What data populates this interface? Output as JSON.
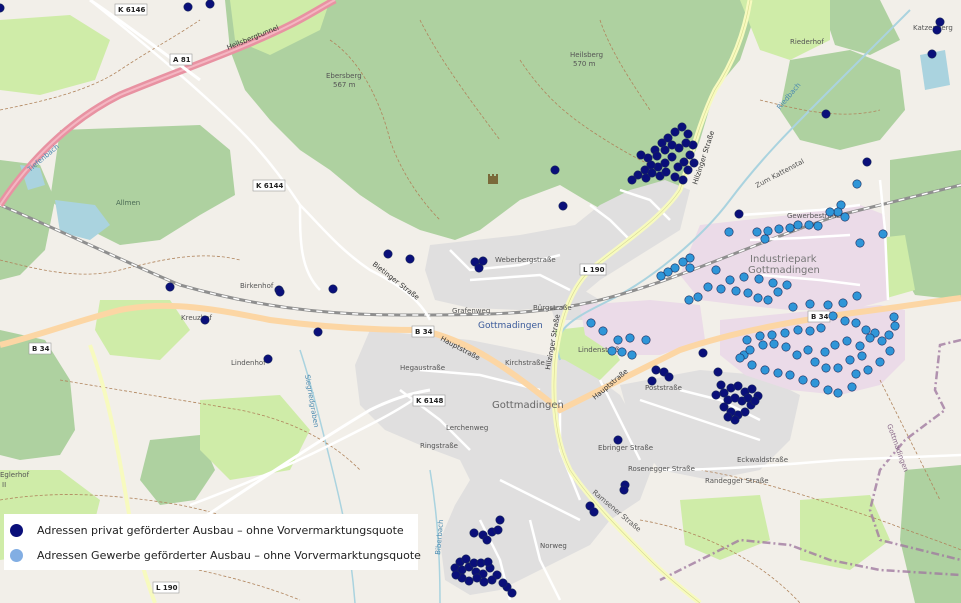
{
  "map": {
    "colors": {
      "land": "#f2efe9",
      "forest": "#aed1a0",
      "forest_dark": "#9cc38c",
      "meadow": "#cfeca8",
      "residential": "#e0dfdf",
      "industrial": "#ebdbe8",
      "motorway": "#e892a2",
      "primary": "#fcd6a4",
      "secondary": "#f7fabf",
      "road": "#ffffff",
      "rail": "#8f8f8f",
      "water": "#aad3df",
      "boundary": "#a07aa0",
      "private_dot": "#0a0f7a",
      "commercial_dot": "#2f96d8"
    },
    "labels": {
      "k6146": "K 6146",
      "heilsbergtunnel": "Heilsbergtunnel",
      "a81": "A 81",
      "ebersberg": "Ebersberg",
      "ebersberg_ele": "567 m",
      "heilsberg": "Heilsberg",
      "heilsberg_ele": "570 m",
      "riederhof": "Riederhof",
      "katzenberg": "Katzenberg",
      "k6144": "K 6144",
      "allmen": "Allmen",
      "birkenhof": "Birkenhof",
      "kreuzhof": "Kreuzhof",
      "lindenhof": "Lindenhof",
      "b34_w": "B 34",
      "b34_c": "B 34",
      "b34_e": "B 34",
      "l190_n": "L 190",
      "l190_s": "L 190",
      "k6148": "K 6148",
      "gottmadingen_station": "Gottmadingen",
      "gottmadingen_town": "Gottmadingen",
      "industriepark": "Industriepark",
      "industriepark2": "Gottmadingen",
      "hauptstrasse": "Hauptstraße",
      "hauptstrasse2": "Hauptstraße",
      "hilzinger": "Hilzinger Straße",
      "hilzinger2": "Hilzinger Straße",
      "bietinger": "Bietinger Straße",
      "gewerbestrasse": "Gewerbestraße",
      "zum_kattenstal": "Zum Kattenstal",
      "grafenweg": "Grafenweg",
      "buergstrasse": "Bürgstraße",
      "rosenegger": "Rosenegger Straße",
      "randegger": "Randegger Straße",
      "eckwaldstrasse": "Eckwaldstraße",
      "lindenstrasse": "Lindenstraße",
      "poststrasse": "Poststraße",
      "norweg": "Norweg",
      "ramsener": "Ramsener Straße",
      "ebringer": "Ebringer Straße",
      "hegau": "Hegaustraße",
      "lerchen": "Lerchenweg",
      "weberbergstrasse": "Weberbergstraße",
      "kirchstrasse": "Kirchstraße",
      "ringstrasse": "Ringstraße",
      "riedbach": "Riedbach",
      "biberbach": "Biberbach",
      "siegriedgraben": "Siegriedgraben",
      "tiefenbach": "Tiefenbach",
      "gottmadingen_line": "Gottmadingen",
      "eglerhof": "Eglerhof",
      "eglerhof2": "II"
    },
    "points_private": [
      [
        0,
        8
      ],
      [
        188,
        7
      ],
      [
        210,
        4
      ],
      [
        940,
        22
      ],
      [
        937,
        30
      ],
      [
        932,
        54
      ],
      [
        826,
        114
      ],
      [
        867,
        162
      ],
      [
        555,
        170
      ],
      [
        563,
        206
      ],
      [
        483,
        261
      ],
      [
        475,
        262
      ],
      [
        479,
        268
      ],
      [
        388,
        254
      ],
      [
        410,
        259
      ],
      [
        333,
        289
      ],
      [
        279,
        290
      ],
      [
        280,
        292
      ],
      [
        170,
        287
      ],
      [
        205,
        320
      ],
      [
        318,
        332
      ],
      [
        268,
        359
      ],
      [
        739,
        214
      ],
      [
        703,
        353
      ],
      [
        656,
        370
      ],
      [
        664,
        372
      ],
      [
        669,
        377
      ],
      [
        652,
        381
      ],
      [
        618,
        440
      ],
      [
        625,
        485
      ],
      [
        624,
        490
      ],
      [
        590,
        506
      ],
      [
        594,
        512
      ],
      [
        641,
        155
      ],
      [
        648,
        158
      ],
      [
        655,
        150
      ],
      [
        662,
        143
      ],
      [
        668,
        138
      ],
      [
        675,
        132
      ],
      [
        682,
        127
      ],
      [
        688,
        134
      ],
      [
        693,
        145
      ],
      [
        690,
        155
      ],
      [
        684,
        162
      ],
      [
        678,
        167
      ],
      [
        672,
        157
      ],
      [
        665,
        163
      ],
      [
        658,
        167
      ],
      [
        651,
        165
      ],
      [
        645,
        170
      ],
      [
        638,
        175
      ],
      [
        632,
        180
      ],
      [
        646,
        178
      ],
      [
        652,
        173
      ],
      [
        660,
        176
      ],
      [
        666,
        172
      ],
      [
        675,
        177
      ],
      [
        683,
        180
      ],
      [
        688,
        170
      ],
      [
        694,
        163
      ],
      [
        686,
        143
      ],
      [
        679,
        148
      ],
      [
        672,
        145
      ],
      [
        665,
        150
      ],
      [
        657,
        156
      ],
      [
        718,
        372
      ],
      [
        721,
        385
      ],
      [
        716,
        395
      ],
      [
        724,
        393
      ],
      [
        731,
        388
      ],
      [
        738,
        386
      ],
      [
        745,
        392
      ],
      [
        752,
        389
      ],
      [
        758,
        396
      ],
      [
        751,
        405
      ],
      [
        745,
        412
      ],
      [
        738,
        415
      ],
      [
        731,
        412
      ],
      [
        724,
        407
      ],
      [
        728,
        400
      ],
      [
        735,
        398
      ],
      [
        742,
        401
      ],
      [
        748,
        398
      ],
      [
        735,
        420
      ],
      [
        728,
        417
      ],
      [
        755,
        401
      ],
      [
        474,
        533
      ],
      [
        483,
        535
      ],
      [
        492,
        532
      ],
      [
        500,
        520
      ],
      [
        498,
        530
      ],
      [
        487,
        540
      ],
      [
        455,
        568
      ],
      [
        462,
        570
      ],
      [
        469,
        567
      ],
      [
        476,
        572
      ],
      [
        483,
        574
      ],
      [
        490,
        568
      ],
      [
        497,
        575
      ],
      [
        492,
        580
      ],
      [
        484,
        582
      ],
      [
        477,
        578
      ],
      [
        469,
        581
      ],
      [
        462,
        578
      ],
      [
        456,
        575
      ],
      [
        460,
        562
      ],
      [
        466,
        559
      ],
      [
        474,
        563
      ],
      [
        481,
        563
      ],
      [
        488,
        562
      ],
      [
        507,
        587
      ],
      [
        512,
        593
      ],
      [
        503,
        583
      ]
    ],
    "points_commercial": [
      [
        857,
        184
      ],
      [
        841,
        205
      ],
      [
        838,
        212
      ],
      [
        845,
        217
      ],
      [
        830,
        212
      ],
      [
        818,
        226
      ],
      [
        809,
        225
      ],
      [
        798,
        225
      ],
      [
        790,
        228
      ],
      [
        779,
        229
      ],
      [
        768,
        231
      ],
      [
        757,
        232
      ],
      [
        765,
        239
      ],
      [
        729,
        232
      ],
      [
        860,
        243
      ],
      [
        883,
        234
      ],
      [
        690,
        258
      ],
      [
        683,
        262
      ],
      [
        675,
        268
      ],
      [
        668,
        272
      ],
      [
        661,
        276
      ],
      [
        690,
        268
      ],
      [
        716,
        270
      ],
      [
        730,
        280
      ],
      [
        744,
        277
      ],
      [
        759,
        279
      ],
      [
        773,
        283
      ],
      [
        787,
        285
      ],
      [
        689,
        300
      ],
      [
        698,
        297
      ],
      [
        708,
        287
      ],
      [
        721,
        289
      ],
      [
        736,
        291
      ],
      [
        748,
        293
      ],
      [
        758,
        298
      ],
      [
        768,
        300
      ],
      [
        778,
        292
      ],
      [
        793,
        307
      ],
      [
        810,
        304
      ],
      [
        828,
        305
      ],
      [
        843,
        303
      ],
      [
        857,
        296
      ],
      [
        591,
        323
      ],
      [
        603,
        331
      ],
      [
        618,
        340
      ],
      [
        630,
        338
      ],
      [
        612,
        351
      ],
      [
        622,
        352
      ],
      [
        632,
        355
      ],
      [
        646,
        340
      ],
      [
        894,
        317
      ],
      [
        895,
        326
      ],
      [
        889,
        335
      ],
      [
        882,
        341
      ],
      [
        875,
        333
      ],
      [
        866,
        330
      ],
      [
        856,
        323
      ],
      [
        845,
        321
      ],
      [
        833,
        316
      ],
      [
        821,
        328
      ],
      [
        810,
        331
      ],
      [
        798,
        330
      ],
      [
        785,
        333
      ],
      [
        772,
        335
      ],
      [
        760,
        336
      ],
      [
        747,
        340
      ],
      [
        744,
        355
      ],
      [
        752,
        365
      ],
      [
        765,
        370
      ],
      [
        778,
        373
      ],
      [
        790,
        375
      ],
      [
        803,
        380
      ],
      [
        815,
        383
      ],
      [
        828,
        390
      ],
      [
        838,
        393
      ],
      [
        852,
        387
      ],
      [
        856,
        374
      ],
      [
        868,
        370
      ],
      [
        880,
        362
      ],
      [
        890,
        351
      ],
      [
        825,
        352
      ],
      [
        835,
        345
      ],
      [
        847,
        341
      ],
      [
        860,
        346
      ],
      [
        870,
        338
      ],
      [
        815,
        362
      ],
      [
        826,
        368
      ],
      [
        838,
        368
      ],
      [
        850,
        360
      ],
      [
        862,
        356
      ],
      [
        808,
        350
      ],
      [
        797,
        355
      ],
      [
        786,
        347
      ],
      [
        774,
        344
      ],
      [
        763,
        345
      ],
      [
        750,
        350
      ],
      [
        740,
        358
      ]
    ]
  },
  "legend": {
    "private_label": "Adressen privat geförderter Ausbau – ohne Vorvermarktungsquote",
    "commercial_label": "Adressen Gewerbe geförderter Ausbau – ohne Vorvermarktungsquote",
    "private_color": "#0a0f7a",
    "commercial_color": "#82aee3"
  }
}
